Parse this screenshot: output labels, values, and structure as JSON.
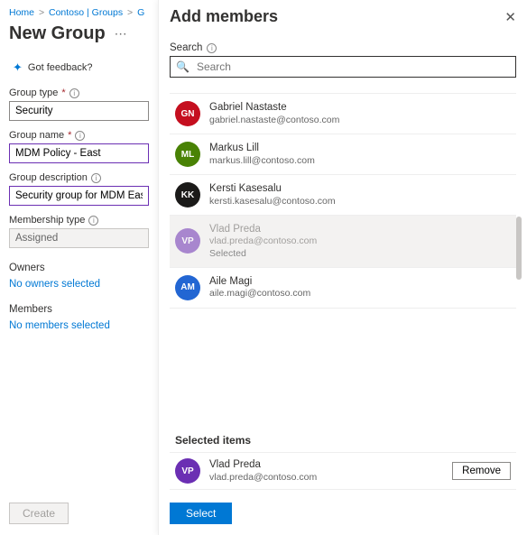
{
  "breadcrumb": {
    "home": "Home",
    "path1": "Contoso | Groups",
    "path2": "G"
  },
  "page_title": "New Group",
  "feedback": "Got feedback?",
  "fields": {
    "group_type_label": "Group type",
    "group_type_value": "Security",
    "group_name_label": "Group name",
    "group_name_value": "MDM Policy - East",
    "group_desc_label": "Group description",
    "group_desc_value": "Security group for MDM East",
    "membership_label": "Membership type",
    "membership_value": "Assigned"
  },
  "owners_label": "Owners",
  "owners_link": "No owners selected",
  "members_label": "Members",
  "members_link": "No members selected",
  "create_label": "Create",
  "panel": {
    "title": "Add members",
    "search_label": "Search",
    "search_placeholder": "Search",
    "selected_heading": "Selected items",
    "remove_label": "Remove",
    "select_label": "Select",
    "selected_status": "Selected"
  },
  "people": [
    {
      "initials": "GN",
      "name": "Gabriel Nastaste",
      "email": "gabriel.nastaste@contoso.com",
      "color": "#c50f1f"
    },
    {
      "initials": "ML",
      "name": "Markus Lill",
      "email": "markus.lill@contoso.com",
      "color": "#498205"
    },
    {
      "initials": "KK",
      "name": "Kersti Kasesalu",
      "email": "kersti.kasesalu@contoso.com",
      "color": "#1b1a19"
    },
    {
      "initials": "VP",
      "name": "Vlad Preda",
      "email": "vlad.preda@contoso.com",
      "color": "#6b2fb3",
      "selected": true
    },
    {
      "initials": "AM",
      "name": "Aile Magi",
      "email": "aile.magi@contoso.com",
      "color": "#2266d3"
    }
  ],
  "selected_item": {
    "initials": "VP",
    "name": "Vlad Preda",
    "email": "vlad.preda@contoso.com",
    "color": "#6b2fb3"
  }
}
